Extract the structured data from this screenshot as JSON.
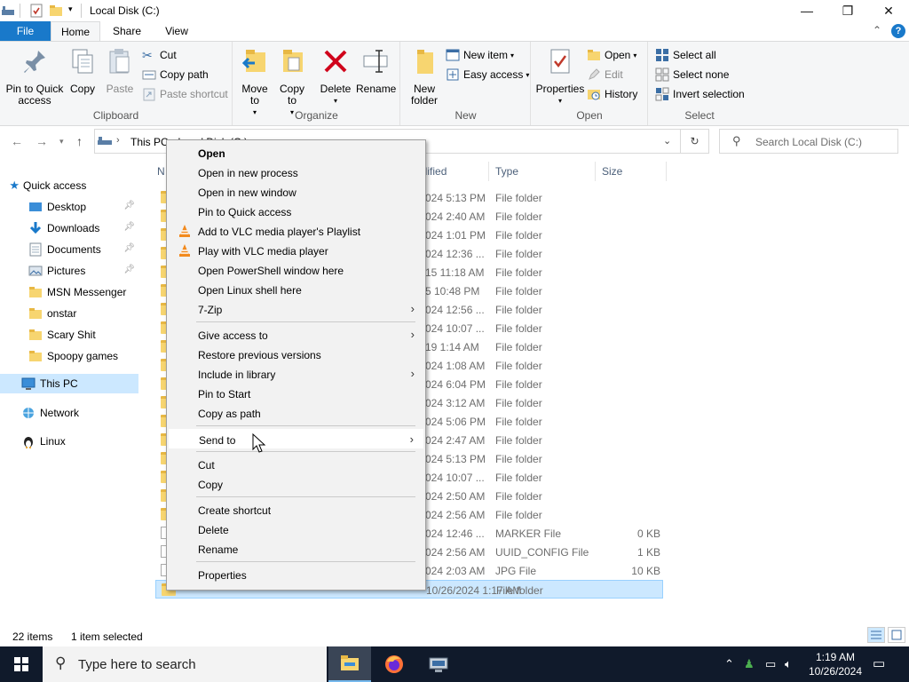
{
  "window": {
    "title": "Local Disk (C:)",
    "controls": {
      "minimize": "—",
      "maximize": "❐",
      "close": "✕"
    }
  },
  "ribbon_tabs": {
    "file": "File",
    "home": "Home",
    "share": "Share",
    "view": "View",
    "help": "?"
  },
  "ribbon": {
    "clipboard": {
      "group": "Clipboard",
      "pin_quick_access": "Pin to Quick access",
      "copy": "Copy",
      "paste": "Paste",
      "cut": "Cut",
      "copy_path": "Copy path",
      "paste_shortcut": "Paste shortcut"
    },
    "organize": {
      "group": "Organize",
      "move_to": "Move to",
      "copy_to": "Copy to",
      "delete": "Delete",
      "rename": "Rename"
    },
    "new": {
      "group": "New",
      "new_folder": "New folder",
      "new_item": "New item",
      "easy_access": "Easy access"
    },
    "open": {
      "group": "Open",
      "properties": "Properties",
      "open": "Open",
      "edit": "Edit",
      "history": "History"
    },
    "select": {
      "group": "Select",
      "select_all": "Select all",
      "select_none": "Select none",
      "invert_selection": "Invert selection"
    }
  },
  "address": {
    "path": "This PC  ›  Local Disk (C:)",
    "search_placeholder": "Search Local Disk (C:)"
  },
  "nav": {
    "quick_access": "Quick access",
    "items": [
      {
        "label": "Desktop",
        "pinned": true
      },
      {
        "label": "Downloads",
        "pinned": true
      },
      {
        "label": "Documents",
        "pinned": true
      },
      {
        "label": "Pictures",
        "pinned": true
      },
      {
        "label": "MSN Messenger",
        "pinned": false
      },
      {
        "label": "onstar",
        "pinned": false
      },
      {
        "label": "Scary Shit",
        "pinned": false
      },
      {
        "label": "Spoopy games",
        "pinned": false
      }
    ],
    "this_pc": "This PC",
    "network": "Network",
    "linux": "Linux"
  },
  "columns": {
    "name": "Name",
    "date": "Date modified",
    "type": "Type",
    "size": "Size"
  },
  "files": [
    {
      "date": "024 5:13 PM",
      "type": "File folder",
      "size": "",
      "kind": "folder"
    },
    {
      "date": "024 2:40 AM",
      "type": "File folder",
      "size": "",
      "kind": "folder"
    },
    {
      "date": "024 1:01 PM",
      "type": "File folder",
      "size": "",
      "kind": "folder"
    },
    {
      "date": "024 12:36 ...",
      "type": "File folder",
      "size": "",
      "kind": "folder"
    },
    {
      "date": "15 11:18 AM",
      "type": "File folder",
      "size": "",
      "kind": "folder"
    },
    {
      "date": "5 10:48 PM",
      "type": "File folder",
      "size": "",
      "kind": "folder"
    },
    {
      "date": "024 12:56 ...",
      "type": "File folder",
      "size": "",
      "kind": "folder"
    },
    {
      "date": "024 10:07 ...",
      "type": "File folder",
      "size": "",
      "kind": "folder"
    },
    {
      "date": "19 1:14 AM",
      "type": "File folder",
      "size": "",
      "kind": "folder"
    },
    {
      "date": "024 1:08 AM",
      "type": "File folder",
      "size": "",
      "kind": "folder"
    },
    {
      "date": "024 6:04 PM",
      "type": "File folder",
      "size": "",
      "kind": "folder"
    },
    {
      "date": "024 3:12 AM",
      "type": "File folder",
      "size": "",
      "kind": "folder"
    },
    {
      "date": "024 5:06 PM",
      "type": "File folder",
      "size": "",
      "kind": "folder"
    },
    {
      "date": "024 2:47 AM",
      "type": "File folder",
      "size": "",
      "kind": "folder"
    },
    {
      "date": "024 5:13 PM",
      "type": "File folder",
      "size": "",
      "kind": "folder"
    },
    {
      "date": "024 10:07 ...",
      "type": "File folder",
      "size": "",
      "kind": "folder"
    },
    {
      "date": "024 2:50 AM",
      "type": "File folder",
      "size": "",
      "kind": "folder"
    },
    {
      "date": "024 2:56 AM",
      "type": "File folder",
      "size": "",
      "kind": "folder"
    },
    {
      "date": "024 12:46 ...",
      "type": "MARKER File",
      "size": "0 KB",
      "kind": "file"
    },
    {
      "date": "024 2:56 AM",
      "type": "UUID_CONFIG File",
      "size": "1 KB",
      "kind": "file"
    },
    {
      "date": "024 2:03 AM",
      "type": "JPG File",
      "size": "10 KB",
      "kind": "file"
    },
    {
      "date": "10/26/2024 1:17 AM",
      "type": "File folder",
      "size": "",
      "kind": "folder",
      "selected": true
    }
  ],
  "status": {
    "count": "22 items",
    "selected": "1 item selected"
  },
  "context_menu": [
    {
      "label": "Open",
      "bold": true
    },
    {
      "label": "Open in new process"
    },
    {
      "label": "Open in new window"
    },
    {
      "label": "Pin to Quick access"
    },
    {
      "label": "Add to VLC media player's Playlist",
      "icon": "vlc-icon"
    },
    {
      "label": "Play with VLC media player",
      "icon": "vlc-icon"
    },
    {
      "label": "Open PowerShell window here"
    },
    {
      "label": "Open Linux shell here"
    },
    {
      "label": "7-Zip",
      "submenu": true
    },
    {
      "sep": true
    },
    {
      "label": "Give access to",
      "submenu": true
    },
    {
      "label": "Restore previous versions"
    },
    {
      "label": "Include in library",
      "submenu": true
    },
    {
      "label": "Pin to Start"
    },
    {
      "label": "Copy as path"
    },
    {
      "sep": true
    },
    {
      "label": "Send to",
      "submenu": true,
      "hover": true
    },
    {
      "sep": true
    },
    {
      "label": "Cut"
    },
    {
      "label": "Copy"
    },
    {
      "sep": true
    },
    {
      "label": "Create shortcut"
    },
    {
      "label": "Delete"
    },
    {
      "label": "Rename"
    },
    {
      "sep": true
    },
    {
      "label": "Properties"
    }
  ],
  "taskbar": {
    "search_placeholder": "Type here to search",
    "time": "1:19 AM",
    "date": "10/26/2024"
  },
  "colors": {
    "accent": "#1979ca",
    "selection": "#cce8ff",
    "taskbar": "#101a2b"
  }
}
